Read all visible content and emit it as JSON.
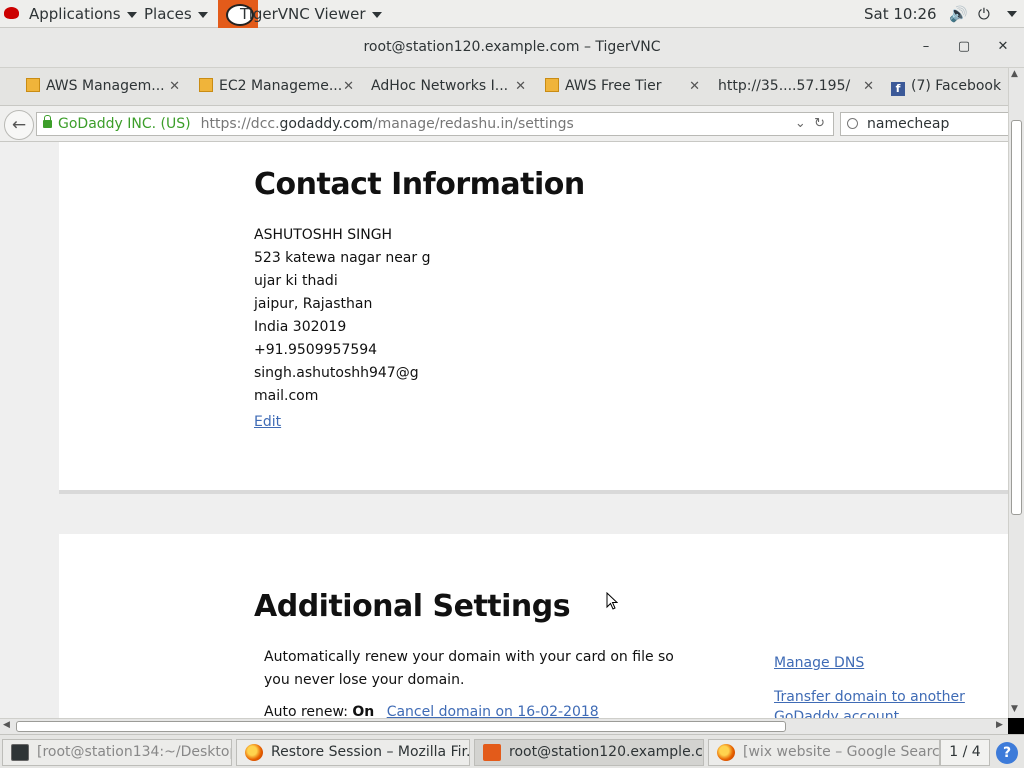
{
  "topbar": {
    "applications": "Applications",
    "places": "Places",
    "active_app": "TigerVNC Viewer",
    "clock": "Sat 10:26",
    "volume_icon": "🔊",
    "power_icon": "⏻"
  },
  "window": {
    "title": "root@station120.example.com – TigerVNC",
    "minimize": "–",
    "maximize": "▢",
    "close": "✕"
  },
  "tabs": [
    {
      "label": "AWS Managem...",
      "icon": "aws-cube",
      "close": "✕"
    },
    {
      "label": "EC2 Manageme...",
      "icon": "aws-cube",
      "close": "✕"
    },
    {
      "label": "AdHoc Networks I...",
      "icon": "",
      "close": "✕"
    },
    {
      "label": "AWS Free Tier",
      "icon": "aws-cube",
      "close": "✕"
    },
    {
      "label": "http://35....57.195/",
      "icon": "",
      "close": "✕"
    },
    {
      "label": "(7) Facebook",
      "icon": "f"
    }
  ],
  "navbar": {
    "back": "←",
    "identity": "GoDaddy INC. (US)",
    "url_prefix": "https://dcc.",
    "url_domain": "godaddy.com",
    "url_path": "/manage/redashu.in/settings",
    "dropdown": "⌄",
    "reload": "↻",
    "search_value": "namecheap"
  },
  "contact": {
    "heading": "Contact Information",
    "lines": [
      "ASHUTOSHH SINGH",
      "523 katewa nagar near g",
      "ujar ki thadi",
      "jaipur, Rajasthan",
      "India 302019",
      "+91.9509957594",
      "singh.ashutoshh947@g",
      "mail.com"
    ],
    "edit": "Edit"
  },
  "additional": {
    "heading": "Additional Settings",
    "renew_text": "Automatically renew your domain with your card on file so you never lose your domain.",
    "auto_renew_label": "Auto renew:",
    "auto_renew_value": "On",
    "cancel_link": "Cancel domain on 16-02-2018",
    "manage_dns": "Manage DNS",
    "transfer_line1": "Transfer domain to another",
    "transfer_line2": "GoDaddy account"
  },
  "taskbar": {
    "items": [
      {
        "label": "[root@station134:~/Desktop]",
        "icon": "terminal"
      },
      {
        "label": "Restore Session – Mozilla Fir...",
        "icon": "firefox"
      },
      {
        "label": "root@station120.example.c...",
        "icon": "tigervnc"
      },
      {
        "label": "[wix website – Google Searc...",
        "icon": "firefox"
      }
    ],
    "pager": "1 / 4",
    "help": "?"
  }
}
